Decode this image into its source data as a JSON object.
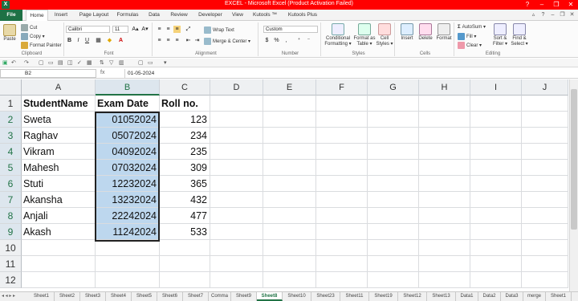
{
  "window": {
    "title": "EXCEL - Microsoft Excel (Product Activation Failed)",
    "app_icon": "X",
    "controls": {
      "minimize": "–",
      "restore": "❐",
      "close": "✕"
    }
  },
  "menu": {
    "tabs": [
      "File",
      "Home",
      "Insert",
      "Page Layout",
      "Formulas",
      "Data",
      "Review",
      "Developer",
      "View",
      "Kutools ™",
      "Kutools Plus"
    ],
    "active": "Home"
  },
  "ribbon": {
    "clipboard": {
      "paste": "Paste",
      "cut": "Cut",
      "copy": "Copy ▾",
      "format_painter": "Format Painter",
      "label": "Clipboard"
    },
    "font": {
      "name": "Calibri",
      "size": "11",
      "bold": "B",
      "italic": "I",
      "underline": "U",
      "grow": "A▴",
      "shrink": "A▾",
      "label": "Font"
    },
    "alignment": {
      "wrap": "Wrap Text",
      "merge": "Merge & Center ▾",
      "label": "Alignment"
    },
    "number": {
      "format": "Custom",
      "currency": "$",
      "percent": "%",
      "comma": ",",
      "label": "Number"
    },
    "styles": {
      "conditional": "Conditional Formatting ▾",
      "format_table": "Format as Table ▾",
      "cell_styles": "Cell Styles ▾",
      "label": "Styles"
    },
    "cells": {
      "insert": "Insert",
      "delete": "Delete",
      "format": "Format",
      "label": "Cells"
    },
    "editing": {
      "autosum": "AutoSum ▾",
      "fill": "Fill ▾",
      "clear": "Clear ▾",
      "sort": "Sort & Filter ▾",
      "find": "Find & Select ▾",
      "label": "Editing"
    }
  },
  "formula_bar": {
    "name_box": "B2",
    "fx": "fx",
    "formula": "01-05-2024"
  },
  "columns": [
    "A",
    "B",
    "C",
    "D",
    "E",
    "F",
    "G",
    "H",
    "I",
    "J"
  ],
  "selected_column": "B",
  "rows": [
    [
      "StudentName",
      "Exam Date",
      "Roll no."
    ],
    [
      "Sweta",
      "01052024",
      "123"
    ],
    [
      "Raghav",
      "05072024",
      "234"
    ],
    [
      "Vikram",
      "04092024",
      "235"
    ],
    [
      "Mahesh",
      "07032024",
      "309"
    ],
    [
      "Stuti",
      "12232024",
      "365"
    ],
    [
      "Akansha",
      "13232024",
      "432"
    ],
    [
      "Anjali",
      "22242024",
      "477"
    ],
    [
      "Akash",
      "11242024",
      "533"
    ],
    [
      "",
      "",
      ""
    ],
    [
      "",
      "",
      ""
    ],
    [
      "",
      "",
      ""
    ]
  ],
  "row_numbers": [
    "1",
    "2",
    "3",
    "4",
    "5",
    "6",
    "7",
    "8",
    "9",
    "10",
    "11",
    "12"
  ],
  "sheet_tabs": [
    "Sheet1",
    "Sheet2",
    "Sheet3",
    "Sheet4",
    "Sheet5",
    "Sheet6",
    "Sheet7",
    "Comma",
    "Sheet9",
    "Sheet8",
    "Sheet10",
    "Sheet23",
    "Sheet11",
    "Sheet19",
    "Sheet12",
    "Sheet13",
    "Data1",
    "Data2",
    "Data3",
    "merge",
    "Sheet1"
  ],
  "active_sheet": "Sheet8",
  "colors": {
    "excel_green": "#217346",
    "title_red": "#ff0000",
    "selection_fill": "#bdd7ee"
  }
}
